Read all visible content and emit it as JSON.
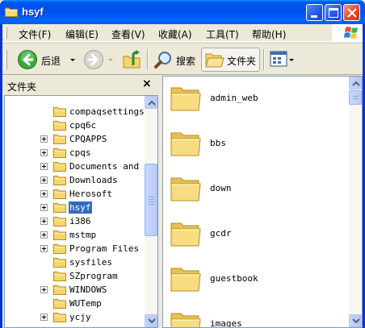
{
  "window": {
    "title": "hsyf"
  },
  "menu": [
    {
      "label": "文件(F)"
    },
    {
      "label": "编辑(E)"
    },
    {
      "label": "查看(V)"
    },
    {
      "label": "收藏(A)"
    },
    {
      "label": "工具(T)"
    },
    {
      "label": "帮助(H)"
    }
  ],
  "toolbar": {
    "back_label": "后退",
    "search_label": "搜索",
    "folders_label": "文件夹"
  },
  "folder_pane": {
    "title": "文件夹",
    "close_glyph": "×",
    "items": [
      {
        "label": "compaqsettings",
        "expandable": false,
        "selected": false
      },
      {
        "label": "cpq6c",
        "expandable": false,
        "selected": false
      },
      {
        "label": "CPQAPPS",
        "expandable": true,
        "selected": false
      },
      {
        "label": "cpqs",
        "expandable": true,
        "selected": false
      },
      {
        "label": "Documents and Se",
        "expandable": true,
        "selected": false
      },
      {
        "label": "Downloads",
        "expandable": true,
        "selected": false
      },
      {
        "label": "Herosoft",
        "expandable": true,
        "selected": false
      },
      {
        "label": "hsyf",
        "expandable": true,
        "selected": true
      },
      {
        "label": "i386",
        "expandable": true,
        "selected": false
      },
      {
        "label": "mstmp",
        "expandable": true,
        "selected": false
      },
      {
        "label": "Program Files",
        "expandable": true,
        "selected": false
      },
      {
        "label": "sysfiles",
        "expandable": false,
        "selected": false
      },
      {
        "label": "SZprogram",
        "expandable": false,
        "selected": false
      },
      {
        "label": "WINDOWS",
        "expandable": true,
        "selected": false
      },
      {
        "label": "WUTemp",
        "expandable": false,
        "selected": false
      },
      {
        "label": "ycjy",
        "expandable": true,
        "selected": false
      }
    ]
  },
  "content": {
    "items": [
      {
        "label": "admin_web"
      },
      {
        "label": "bbs"
      },
      {
        "label": "down"
      },
      {
        "label": "gcdr"
      },
      {
        "label": "guestbook"
      },
      {
        "label": "images"
      }
    ]
  },
  "colors": {
    "titlebar": "#0054e3",
    "selection": "#316ac5",
    "folder_yellow": "#f5d66b"
  }
}
